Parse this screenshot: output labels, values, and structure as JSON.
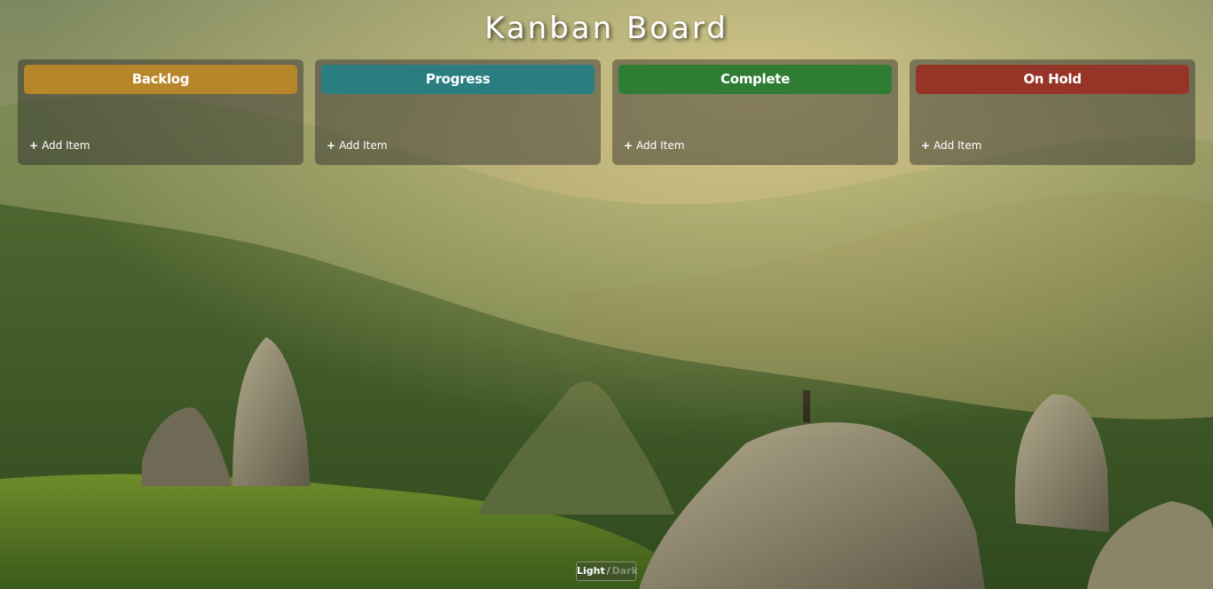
{
  "page": {
    "title": "Kanban Board"
  },
  "columns": [
    {
      "name": "Backlog",
      "color": "#b8862a",
      "add_label": "Add Item",
      "add_icon": "plus-icon"
    },
    {
      "name": "Progress",
      "color": "#2a7e80",
      "add_label": "Add Item",
      "add_icon": "plus-icon"
    },
    {
      "name": "Complete",
      "color": "#2f7c34",
      "add_label": "Add Item",
      "add_icon": "plus-icon"
    },
    {
      "name": "On Hold",
      "color": "#963527",
      "add_label": "Add Item",
      "add_icon": "plus-icon"
    }
  ],
  "theme_toggle": {
    "light_label": "Light",
    "separator": "/",
    "dark_label": "Dark",
    "active": "Light"
  },
  "background": {
    "description_icon": "mountain-landscape-image"
  }
}
